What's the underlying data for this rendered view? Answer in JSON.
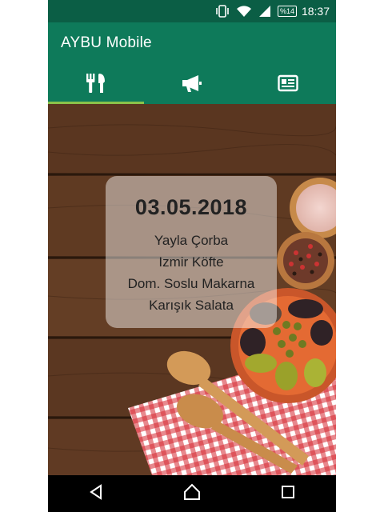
{
  "status_bar": {
    "battery_label": "%14",
    "time": "18:37",
    "icons": [
      "vibrate-icon",
      "wifi-icon",
      "signal-icon",
      "battery-icon"
    ]
  },
  "app_bar": {
    "title": "AYBU Mobile"
  },
  "tabs": [
    {
      "icon": "restaurant-icon",
      "active": true
    },
    {
      "icon": "megaphone-icon",
      "active": false
    },
    {
      "icon": "news-icon",
      "active": false
    }
  ],
  "menu": {
    "date": "03.05.2018",
    "items": [
      "Yayla Çorba",
      "Izmir Köfte",
      "Dom. Soslu Makarna",
      "Karışık Salata"
    ]
  },
  "nav_bar": {
    "icons": [
      "back-icon",
      "home-icon",
      "recents-icon"
    ]
  },
  "colors": {
    "status_bar": "#0b5e45",
    "primary": "#0e7a5a",
    "tab_indicator": "#8bc34a"
  }
}
